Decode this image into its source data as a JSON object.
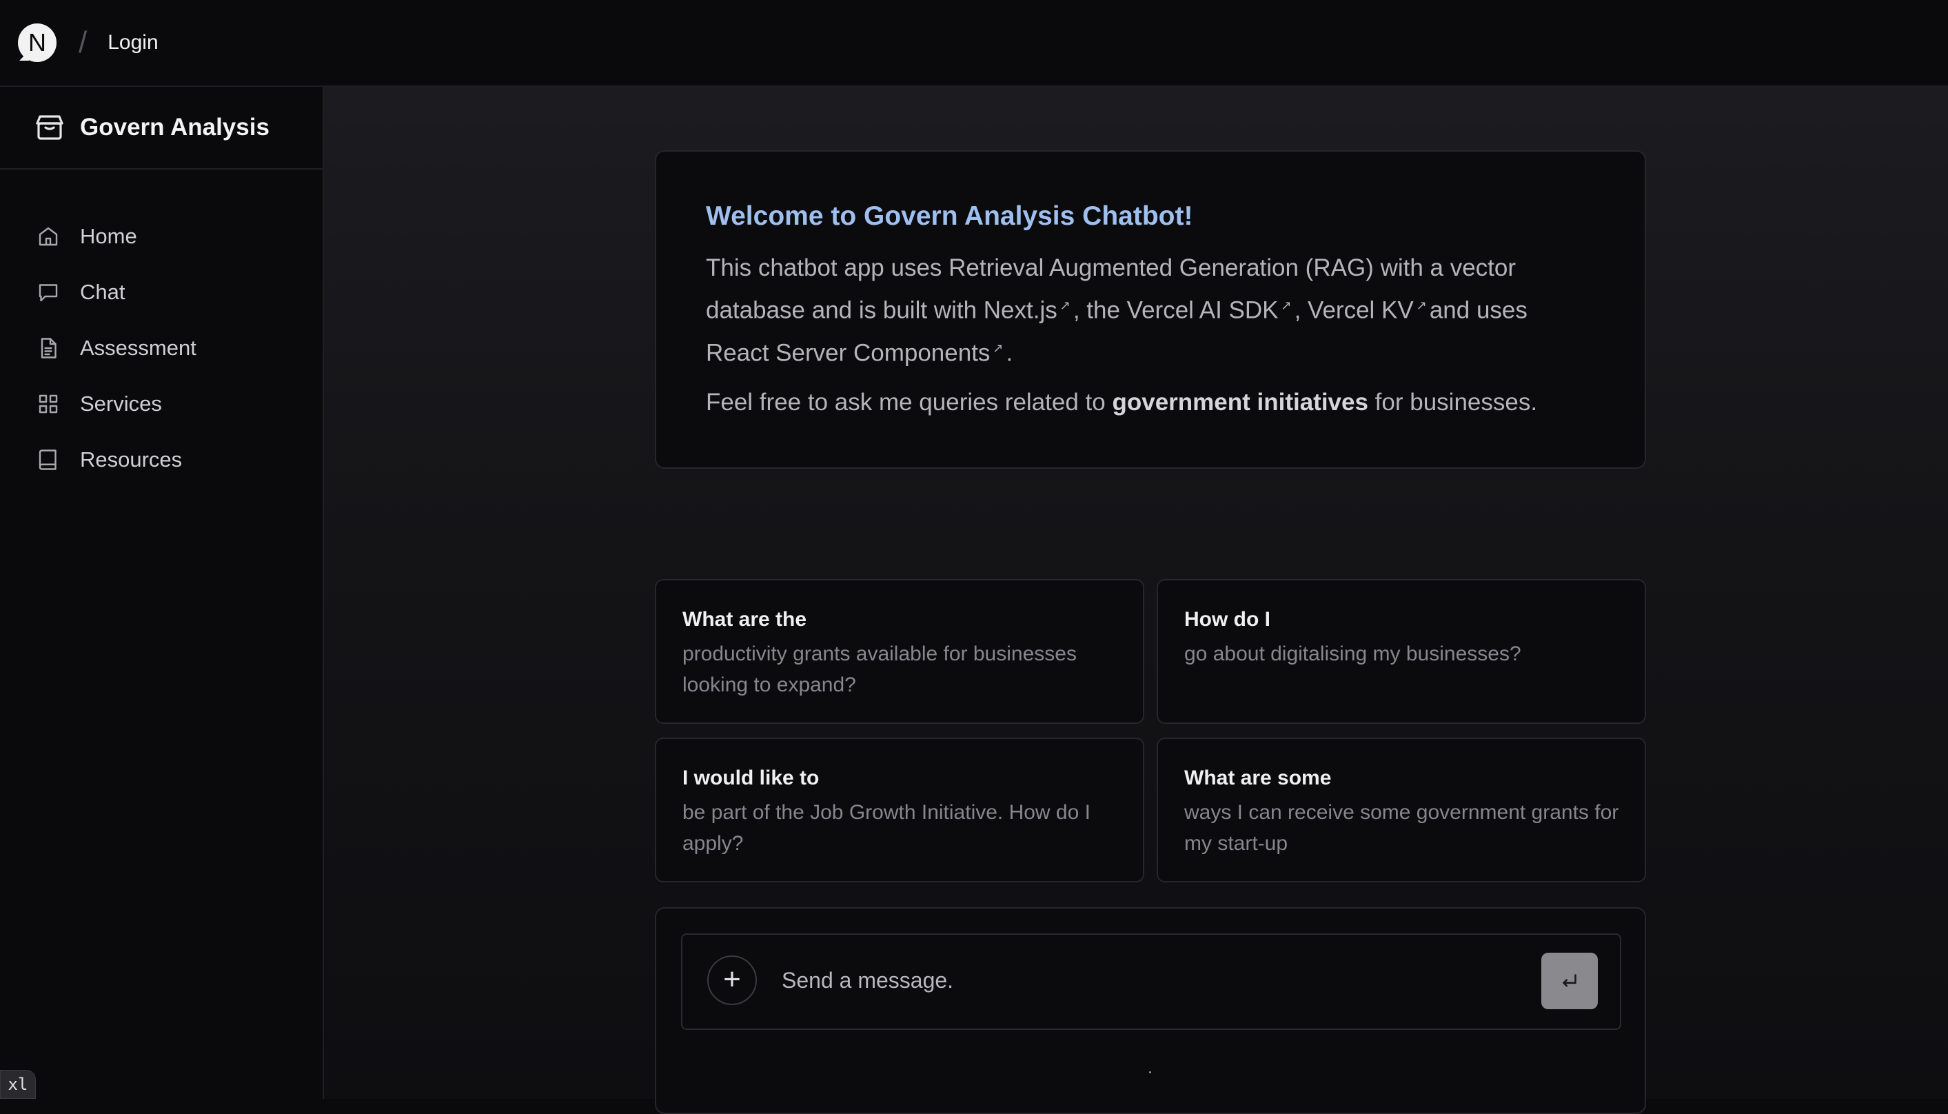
{
  "topbar": {
    "logo_letter": "N",
    "separator": "/",
    "login_label": "Login"
  },
  "sidebar": {
    "brand_title": "Govern Analysis",
    "brand_icon": "store-icon",
    "items": [
      {
        "label": "Home",
        "icon": "home-icon"
      },
      {
        "label": "Chat",
        "icon": "message-icon"
      },
      {
        "label": "Assessment",
        "icon": "document-icon"
      },
      {
        "label": "Services",
        "icon": "grid-icon"
      },
      {
        "label": "Resources",
        "icon": "book-icon"
      }
    ]
  },
  "welcome": {
    "title": "Welcome to Govern Analysis Chatbot!",
    "desc_prefix": "This chatbot app uses Retrieval Augmented Generation (RAG) with a vector database and is built with ",
    "link_nextjs": "Next.js",
    "sep1": ", the ",
    "link_ai_sdk": "Vercel AI SDK",
    "sep2": ", ",
    "link_kv": "Vercel KV",
    "sep3": "and uses ",
    "link_rsc": "React Server Components",
    "desc_suffix": ".",
    "ext_glyph": "↗",
    "line2_prefix": "Feel free to ask me queries related to ",
    "line2_bold": "government initiatives",
    "line2_suffix": " for businesses.",
    "title_color": "#9fbfee"
  },
  "suggestions": [
    {
      "heading": "What are the",
      "body": "productivity grants available for businesses looking to expand?"
    },
    {
      "heading": "How do I",
      "body": "go about digitalising my businesses?"
    },
    {
      "heading": "I would like to",
      "body": "be part of the Job Growth Initiative. How do I apply?"
    },
    {
      "heading": "What are some",
      "body": "ways I can receive some government grants for my start-up"
    }
  ],
  "composer": {
    "plus_label": "+",
    "placeholder": "Send a message.",
    "value": "",
    "send_icon": "enter-icon"
  },
  "badge": {
    "label": "xl"
  }
}
